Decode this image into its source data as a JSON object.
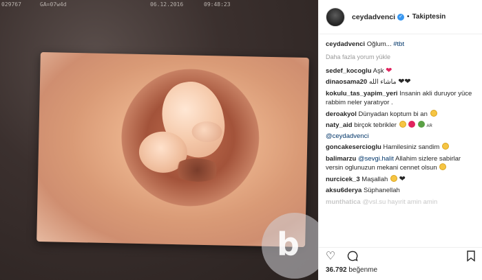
{
  "scan": {
    "id": "029767",
    "ga": "GA=07w4d",
    "date": "06.12.2016",
    "time": "09:48:23"
  },
  "watermark": {
    "letter": "b"
  },
  "post": {
    "username": "ceydadvenci",
    "follow_status": "Takiptesin",
    "dot": "•",
    "verified_icon": "verified-badge-icon",
    "caption_user": "ceydadvenci",
    "caption_text": "Oğlum...",
    "caption_tag": "#tbt",
    "load_more": "Daha fazla yorum yükle"
  },
  "comments": [
    {
      "user": "sedef_kocoglu",
      "text": "Aşk"
    },
    {
      "user": "dinaosama20",
      "text": "ماشاء الله"
    },
    {
      "user": "kokulu_tas_yapim_yeri",
      "text": "Insanin akli duruyor yüce rabbim neler yaratıyor ."
    },
    {
      "user": "deroakyol",
      "text": "Dünyadan koptum bi an"
    },
    {
      "user": "naty_aid",
      "text": "birçok tebrikler",
      "suffix": "AR",
      "mention": "@ceydadvenci"
    },
    {
      "user": "goncakesercioglu",
      "text": "Hamilesiniz sandim"
    },
    {
      "user": "balimarzu",
      "mention": "@sevgi.halit",
      "text": "Allahim sizlere sabirlar versin oglunuzun mekani cennet olsun"
    },
    {
      "user": "nurcicek_3",
      "text": "Maşallah"
    },
    {
      "user": "aksu6derya",
      "text": "Süphanellah"
    },
    {
      "user": "munthatica",
      "text": "@vsl.su hayırit amin amin"
    }
  ],
  "actions": {
    "like_icon": "heart-outline-icon",
    "comment_icon": "comment-bubble-icon",
    "save_icon": "bookmark-icon"
  },
  "likes": {
    "count": "36.792",
    "label": "beğenme"
  },
  "colors": {
    "link": "#003569",
    "verified": "#3897f0",
    "heart": "#e0245e"
  }
}
